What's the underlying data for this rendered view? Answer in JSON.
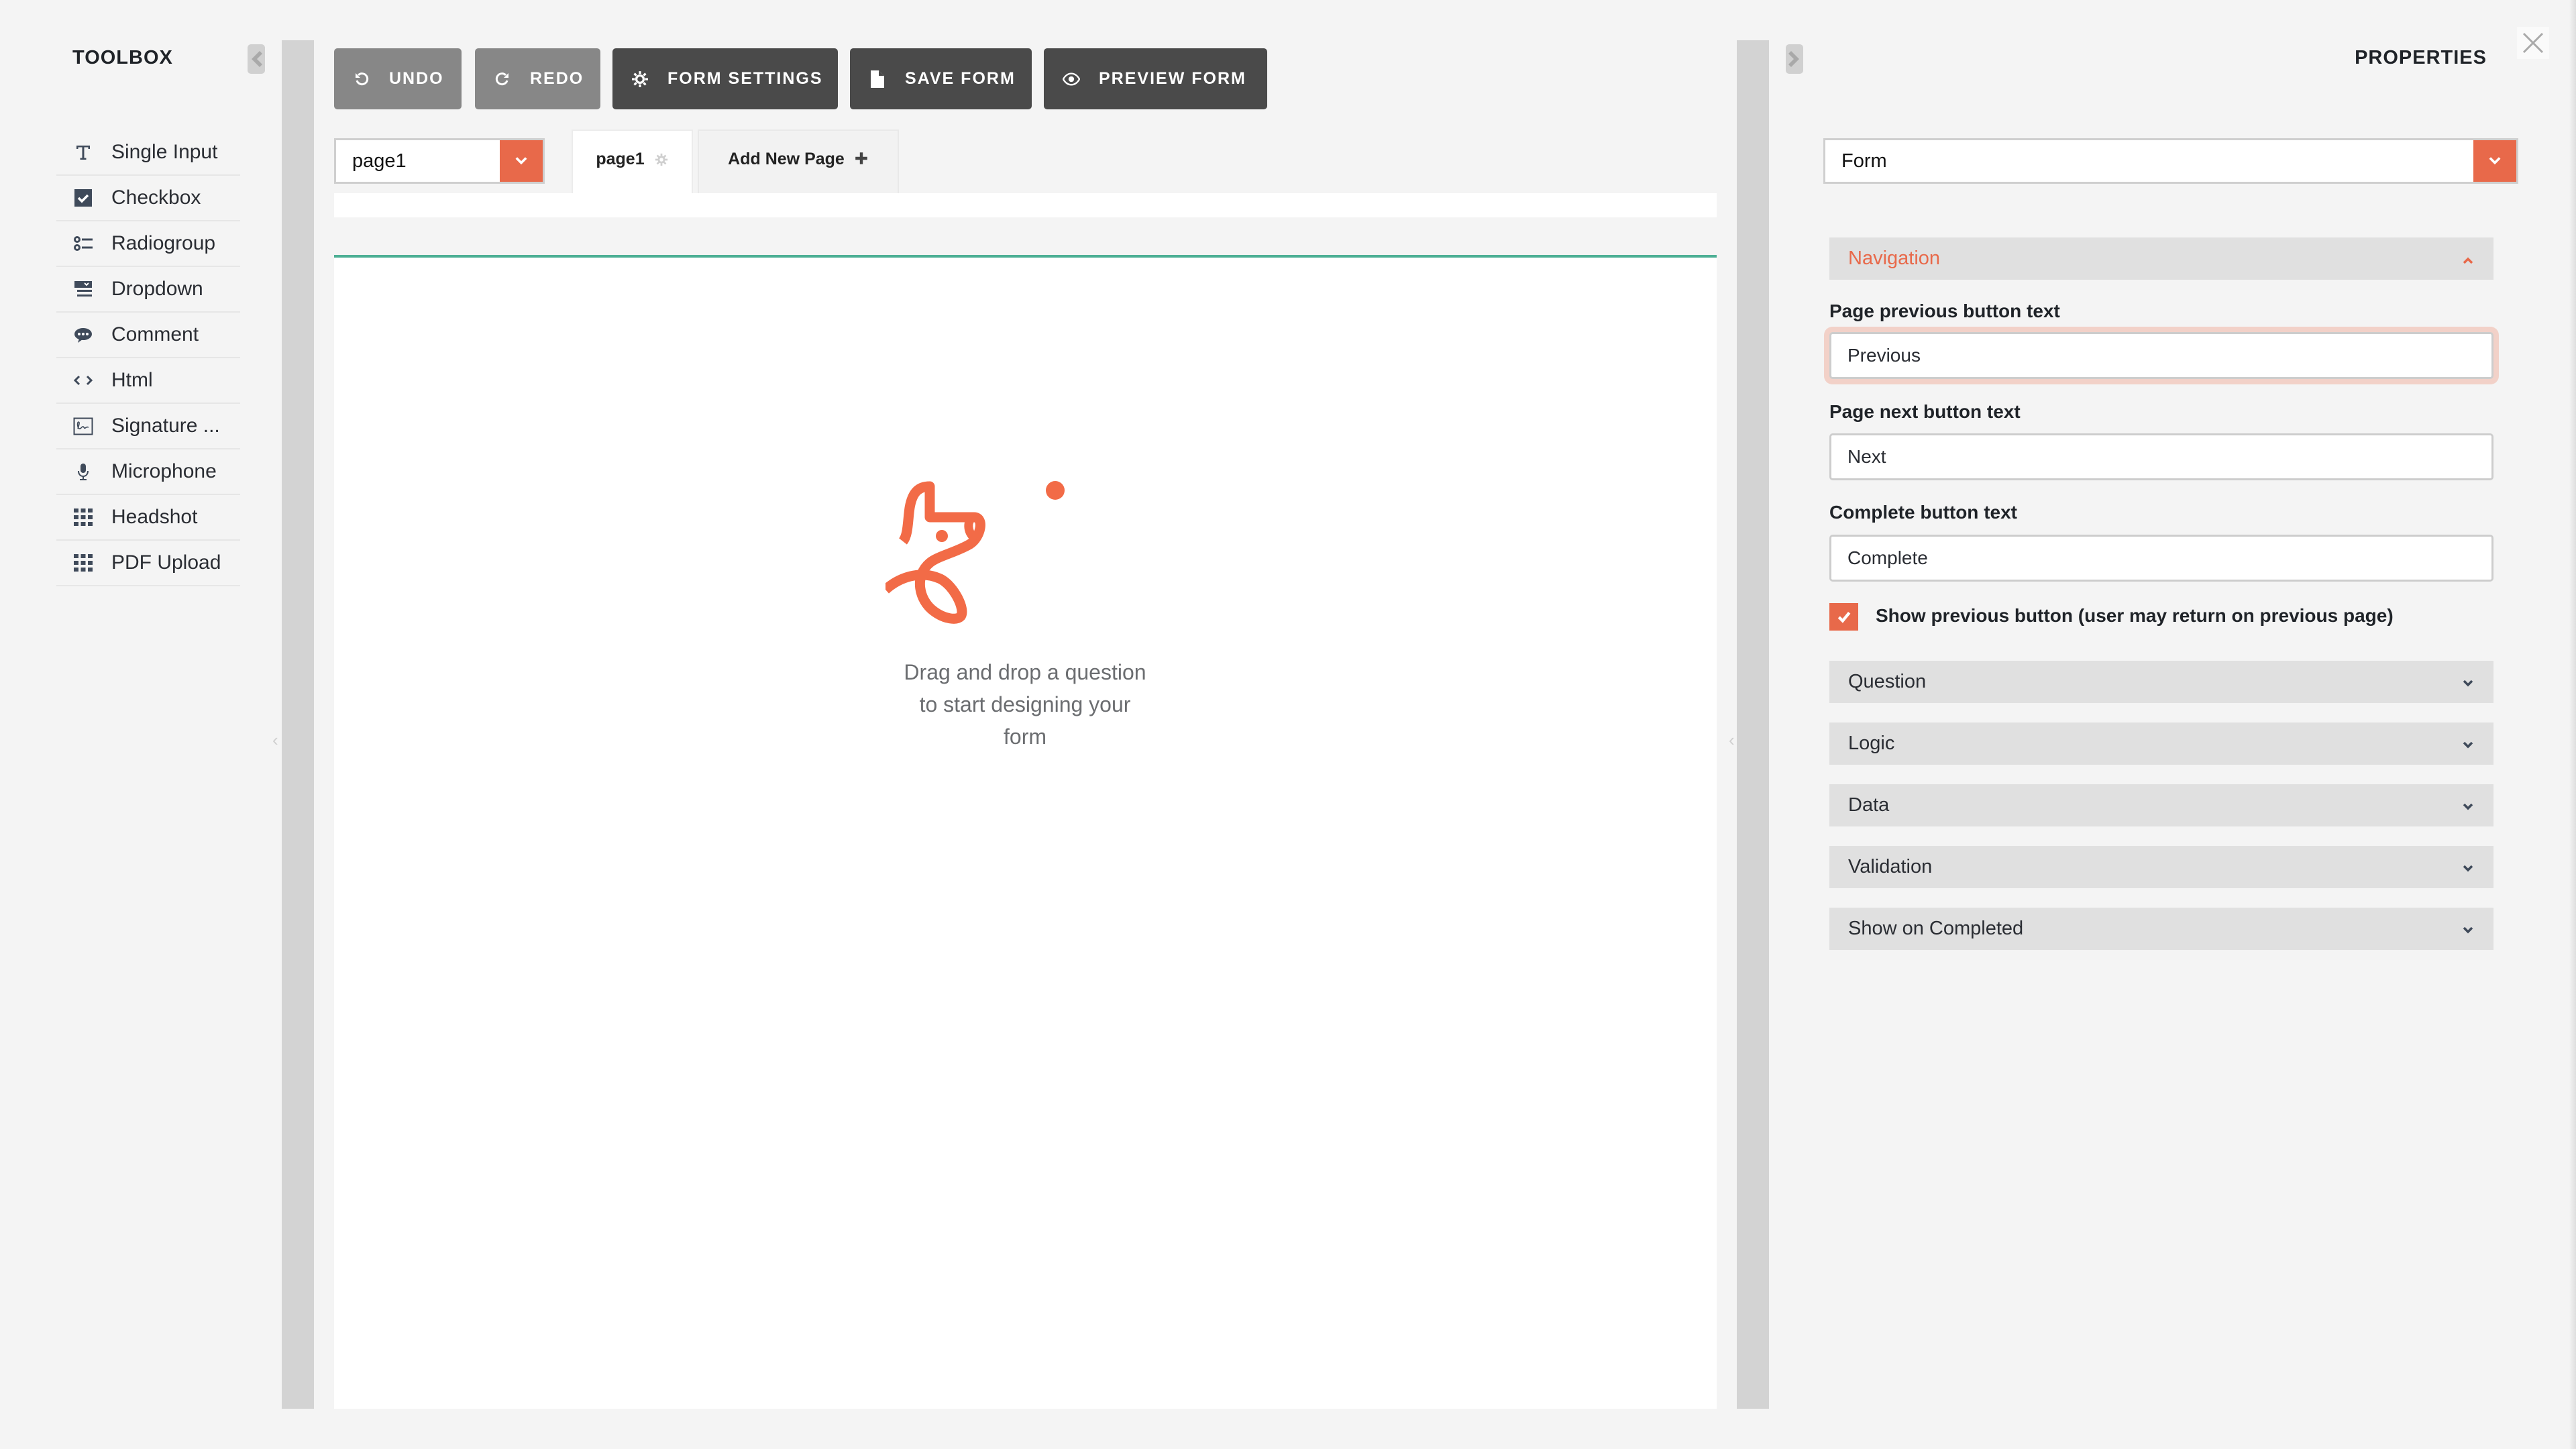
{
  "toolbox": {
    "title": "TOOLBOX",
    "collapse_icon": "chevron-left-icon",
    "items": [
      {
        "label": "Single Input",
        "icon": "text-icon"
      },
      {
        "label": "Checkbox",
        "icon": "checkbox-icon"
      },
      {
        "label": "Radiogroup",
        "icon": "radiogroup-icon"
      },
      {
        "label": "Dropdown",
        "icon": "dropdown-icon"
      },
      {
        "label": "Comment",
        "icon": "comment-icon"
      },
      {
        "label": "Html",
        "icon": "code-icon"
      },
      {
        "label": "Signature ...",
        "icon": "signature-icon"
      },
      {
        "label": "Microphone",
        "icon": "microphone-icon"
      },
      {
        "label": "Headshot",
        "icon": "grid-icon"
      },
      {
        "label": "PDF Upload",
        "icon": "grid-icon"
      }
    ]
  },
  "toolbar": {
    "undo": "UNDO",
    "redo": "REDO",
    "form_settings": "FORM SETTINGS",
    "save_form": "SAVE FORM",
    "preview_form": "PREVIEW FORM"
  },
  "pages": {
    "selected": "page1",
    "tabs": [
      {
        "label": "page1"
      }
    ],
    "add_label": "Add New Page"
  },
  "canvas": {
    "empty_line1": "Drag and drop a question",
    "empty_line2": "to start designing your",
    "empty_line3": "form"
  },
  "properties": {
    "title": "PROPERTIES",
    "object_selected": "Form",
    "sections": {
      "navigation": "Navigation",
      "question": "Question",
      "logic": "Logic",
      "data": "Data",
      "validation": "Validation",
      "show_on_completed": "Show on Completed"
    },
    "fields": {
      "prev_label": "Page previous button text",
      "prev_value": "Previous",
      "next_label": "Page next button text",
      "next_value": "Next",
      "complete_label": "Complete button text",
      "complete_value": "Complete",
      "show_prev_label": "Show previous button (user may return on previous page)",
      "show_prev_checked": true
    }
  },
  "colors": {
    "accent": "#e8694a",
    "canvas_line": "#4caf94",
    "dark_button": "#4a4a4a",
    "light_button": "#878787"
  }
}
